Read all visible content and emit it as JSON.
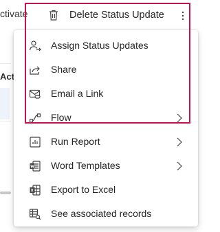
{
  "background": {
    "activate_label": "ctivate",
    "column_label": "Acti"
  },
  "command_bar": {
    "delete_label": "Delete Status Update",
    "icons": {
      "delete": "trash-icon",
      "more": "more-vertical-icon"
    }
  },
  "menu": {
    "items": [
      {
        "label": "Assign Status Updates",
        "icon": "assign-person-icon",
        "has_submenu": false
      },
      {
        "label": "Share",
        "icon": "share-icon",
        "has_submenu": false
      },
      {
        "label": "Email a Link",
        "icon": "email-link-icon",
        "has_submenu": false
      },
      {
        "label": "Flow",
        "icon": "flow-icon",
        "has_submenu": true
      },
      {
        "label": "Run Report",
        "icon": "report-icon",
        "has_submenu": true
      },
      {
        "label": "Word Templates",
        "icon": "word-icon",
        "has_submenu": true
      },
      {
        "label": "Export to Excel",
        "icon": "excel-icon",
        "has_submenu": false
      },
      {
        "label": "See associated records",
        "icon": "associated-records-icon",
        "has_submenu": false
      }
    ]
  },
  "colors": {
    "highlight_border": "#c4134d",
    "text": "#242424",
    "icon": "#424242"
  }
}
